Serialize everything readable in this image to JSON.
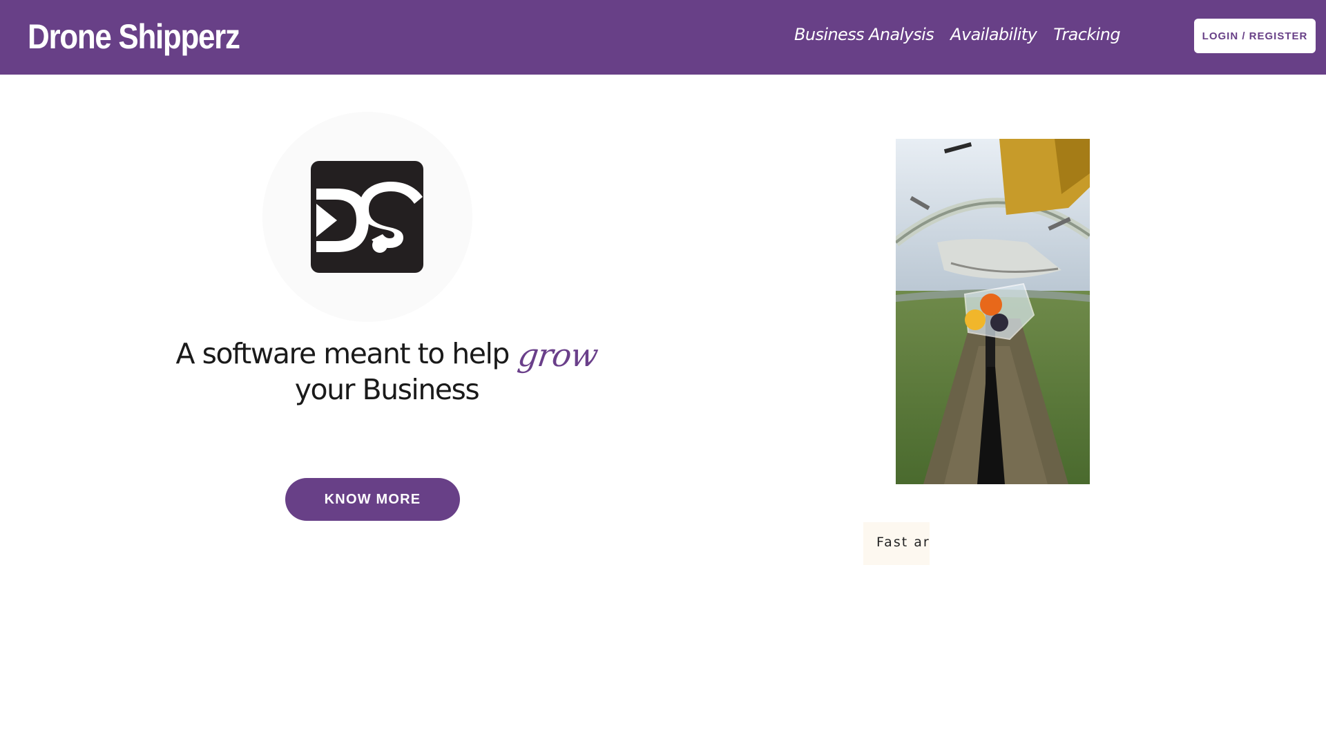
{
  "navbar": {
    "brand": "Drone Shipperz",
    "links": [
      {
        "label": "Business Analysis"
      },
      {
        "label": "Availability"
      },
      {
        "label": "Tracking"
      }
    ],
    "login_label": "LOGIN / REGISTER",
    "background_color": "#684087"
  },
  "hero": {
    "logo_text": "D.S",
    "headline_part1": "A software meant to help",
    "headline_accent": "grow",
    "headline_part2": "your Business",
    "cta_label": "KNOW MORE",
    "accent_color": "#684087"
  },
  "media": {
    "image_subject": "drone-delivery-photo",
    "caption": "Fast ar"
  }
}
